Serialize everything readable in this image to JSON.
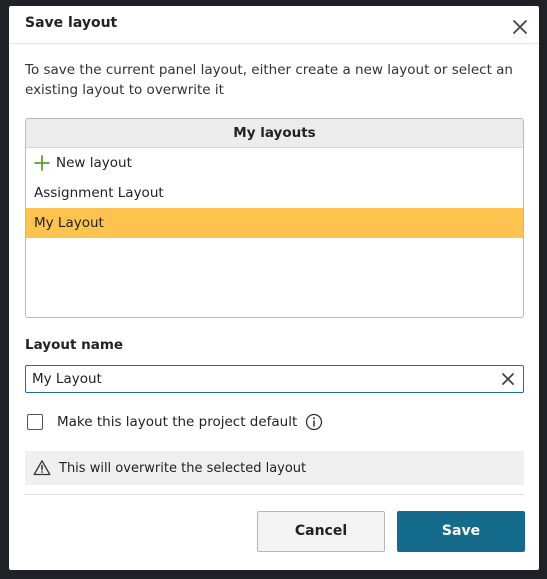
{
  "dialog": {
    "title": "Save layout",
    "description": "To save the current panel layout, either create a new layout or select an existing layout to overwrite it"
  },
  "layouts": {
    "header": "My layouts",
    "new_label": "New layout",
    "items": [
      {
        "label": "Assignment Layout",
        "selected": false
      },
      {
        "label": "My Layout",
        "selected": true
      }
    ]
  },
  "name_field": {
    "label": "Layout name",
    "value": "My Layout"
  },
  "default_checkbox": {
    "label": "Make this layout the project default",
    "checked": false
  },
  "warning": {
    "text": "This will overwrite the selected layout"
  },
  "buttons": {
    "cancel": "Cancel",
    "save": "Save"
  },
  "colors": {
    "selected_row": "#fcc44e",
    "primary": "#156b8b",
    "plus": "#5a9e2f"
  },
  "icons": {
    "close": "close-icon",
    "plus": "plus-icon",
    "clear": "clear-icon",
    "info": "info-icon",
    "warning": "warning-icon"
  }
}
